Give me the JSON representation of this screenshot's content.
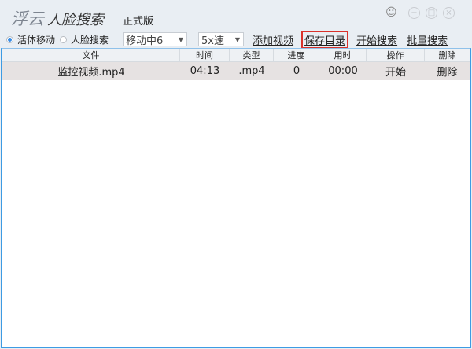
{
  "app": {
    "logo_part1": "浮云",
    "logo_part2": "人脸搜索",
    "edition": "正式版"
  },
  "window": {
    "user_icon": "user-icon",
    "minimize": "−",
    "restore": "□",
    "close": "×"
  },
  "toolbar": {
    "modes": [
      {
        "label": "活体移动",
        "selected": true
      },
      {
        "label": "人脸搜索",
        "selected": false
      }
    ],
    "motion_select": "移动中6",
    "speed_select": "5x速",
    "add_video": "添加视频",
    "save_dir": "保存目录",
    "start_search": "开始搜索",
    "batch_search": "批量搜索"
  },
  "table": {
    "columns": [
      "文件",
      "时间",
      "类型",
      "进度",
      "用时",
      "操作",
      "删除"
    ],
    "rows": [
      [
        "监控视频.mp4",
        "04:13",
        ".mp4",
        "0",
        "00:00",
        "开始",
        "删除"
      ]
    ]
  }
}
